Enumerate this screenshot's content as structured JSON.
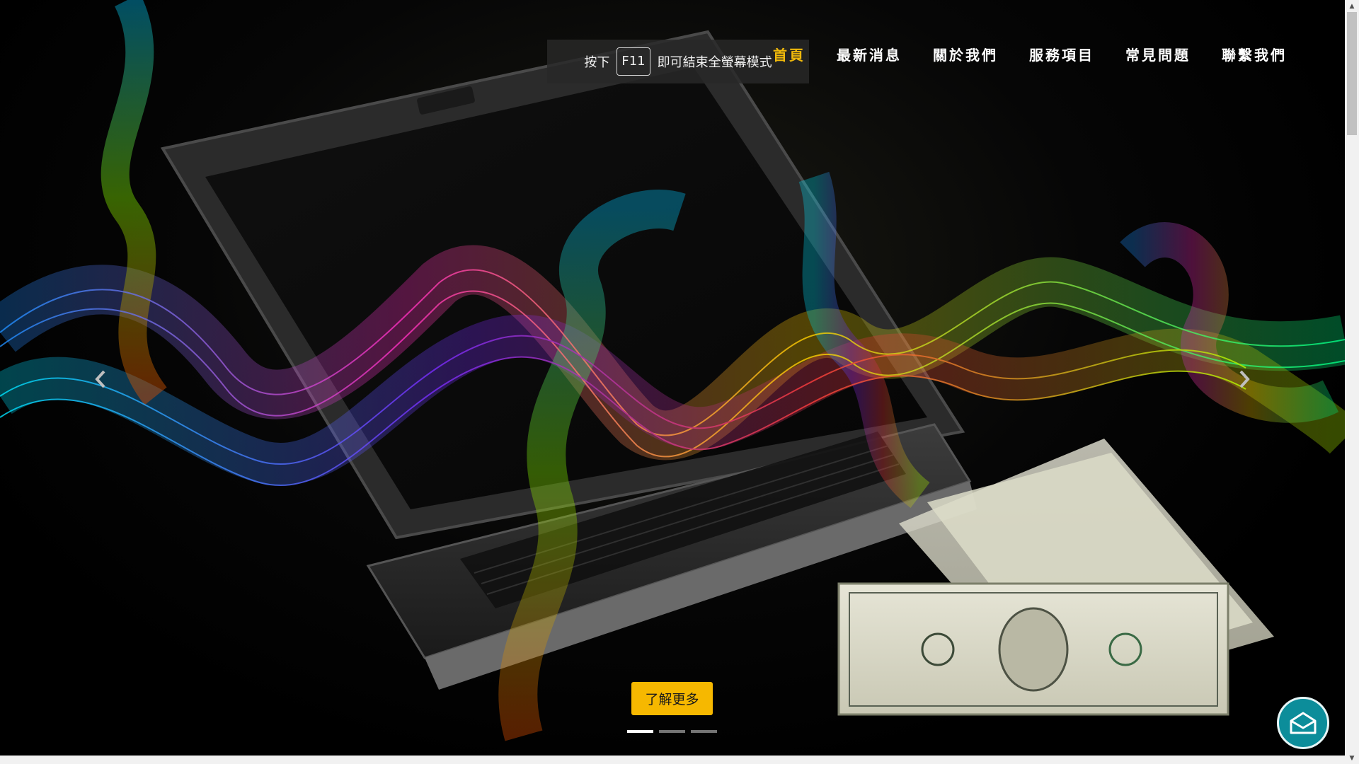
{
  "nav": {
    "items": [
      {
        "label": "首頁",
        "active": true
      },
      {
        "label": "最新消息",
        "active": false
      },
      {
        "label": "關於我們",
        "active": false
      },
      {
        "label": "服務項目",
        "active": false
      },
      {
        "label": "常見問題",
        "active": false
      },
      {
        "label": "聯繫我們",
        "active": false
      }
    ],
    "active_color": "#f0b90b"
  },
  "fullscreen_notice": {
    "prefix": "按下",
    "key": "F11",
    "suffix": "即可結束全螢幕模式"
  },
  "carousel": {
    "prev_icon": "chevron-left-icon",
    "next_icon": "chevron-right-icon",
    "cta_label": "了解更多",
    "cta_color": "#f6b800",
    "slide_count": 3,
    "active_slide": 1
  },
  "contact": {
    "icon": "mail-icon",
    "color": "#0c8d9a"
  }
}
